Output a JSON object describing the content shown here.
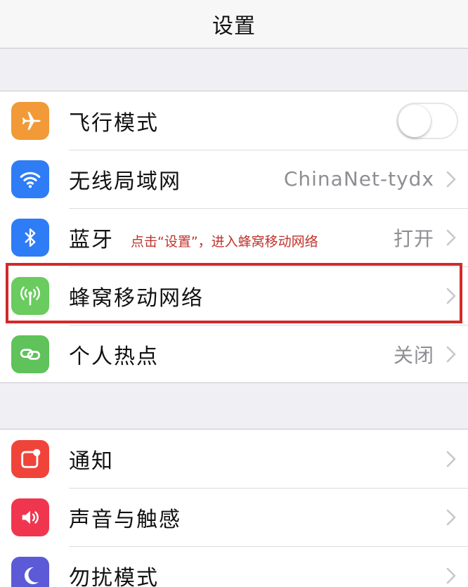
{
  "nav": {
    "title": "设置"
  },
  "colors": {
    "airplane": "#f19a37",
    "wifi": "#2e7cf6",
    "bluetooth": "#2e7cf6",
    "cellular": "#6acb5f",
    "hotspot": "#5fc25a",
    "notifications": "#f0443a",
    "sounds": "#f0364f",
    "dnd": "#5c5ad6",
    "annotation": "#c0332c"
  },
  "group1": {
    "airplane": {
      "label": "飞行模式",
      "icon": "airplane-icon",
      "toggle_on": false
    },
    "wifi": {
      "label": "无线局域网",
      "value": "ChinaNet-tydx",
      "icon": "wifi-icon"
    },
    "bluetooth": {
      "label": "蓝牙",
      "value": "打开",
      "icon": "bluetooth-icon"
    },
    "cellular": {
      "label": "蜂窝移动网络",
      "icon": "cellular-icon"
    },
    "hotspot": {
      "label": "个人热点",
      "value": "关闭",
      "icon": "hotspot-icon"
    }
  },
  "group2": {
    "notifications": {
      "label": "通知",
      "icon": "notifications-icon"
    },
    "sounds": {
      "label": "声音与触感",
      "icon": "speaker-icon"
    },
    "dnd": {
      "label": "勿扰模式",
      "icon": "moon-icon"
    }
  },
  "annotation": {
    "text": "点击“设置”，进入蜂窝移动网络"
  }
}
